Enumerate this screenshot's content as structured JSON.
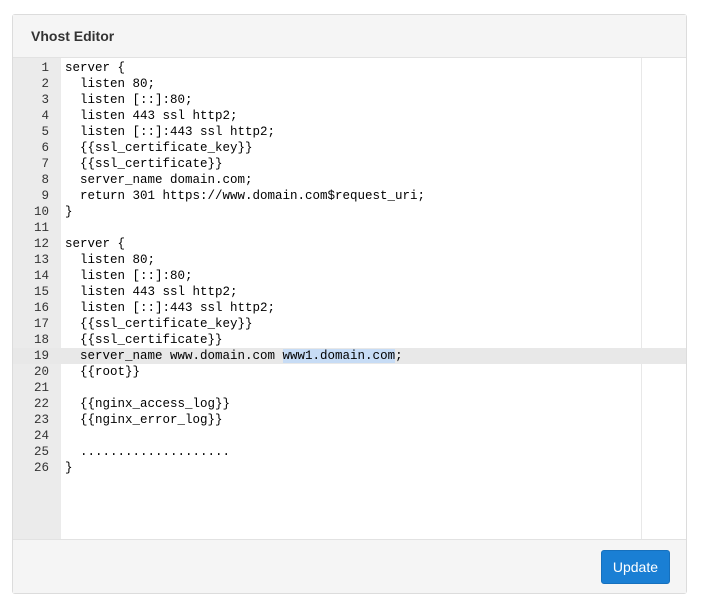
{
  "panel": {
    "title": "Vhost Editor"
  },
  "editor": {
    "active_line": 19,
    "lines": [
      {
        "num": "1",
        "text": "server {"
      },
      {
        "num": "2",
        "text": "  listen 80;"
      },
      {
        "num": "3",
        "text": "  listen [::]:80;"
      },
      {
        "num": "4",
        "text": "  listen 443 ssl http2;"
      },
      {
        "num": "5",
        "text": "  listen [::]:443 ssl http2;"
      },
      {
        "num": "6",
        "text": "  {{ssl_certificate_key}}"
      },
      {
        "num": "7",
        "text": "  {{ssl_certificate}}"
      },
      {
        "num": "8",
        "text": "  server_name domain.com;"
      },
      {
        "num": "9",
        "text": "  return 301 https://www.domain.com$request_uri;"
      },
      {
        "num": "10",
        "text": "}"
      },
      {
        "num": "11",
        "text": ""
      },
      {
        "num": "12",
        "text": "server {"
      },
      {
        "num": "13",
        "text": "  listen 80;"
      },
      {
        "num": "14",
        "text": "  listen [::]:80;"
      },
      {
        "num": "15",
        "text": "  listen 443 ssl http2;"
      },
      {
        "num": "16",
        "text": "  listen [::]:443 ssl http2;"
      },
      {
        "num": "17",
        "text": "  {{ssl_certificate_key}}"
      },
      {
        "num": "18",
        "text": "  {{ssl_certificate}}"
      },
      {
        "num": "19",
        "text_before": "  server_name www.domain.com ",
        "selected": "www1.domain.com",
        "text_after": ";"
      },
      {
        "num": "20",
        "text": "  {{root}}"
      },
      {
        "num": "21",
        "text": ""
      },
      {
        "num": "22",
        "text": "  {{nginx_access_log}}"
      },
      {
        "num": "23",
        "text": "  {{nginx_error_log}}"
      },
      {
        "num": "24",
        "text": ""
      },
      {
        "num": "25",
        "text": "  ...................."
      },
      {
        "num": "26",
        "text": "}"
      }
    ]
  },
  "footer": {
    "update_label": "Update"
  },
  "colors": {
    "accent": "#1a7fd4",
    "selection": "#c7dcf5",
    "gutter": "#ebebeb"
  }
}
